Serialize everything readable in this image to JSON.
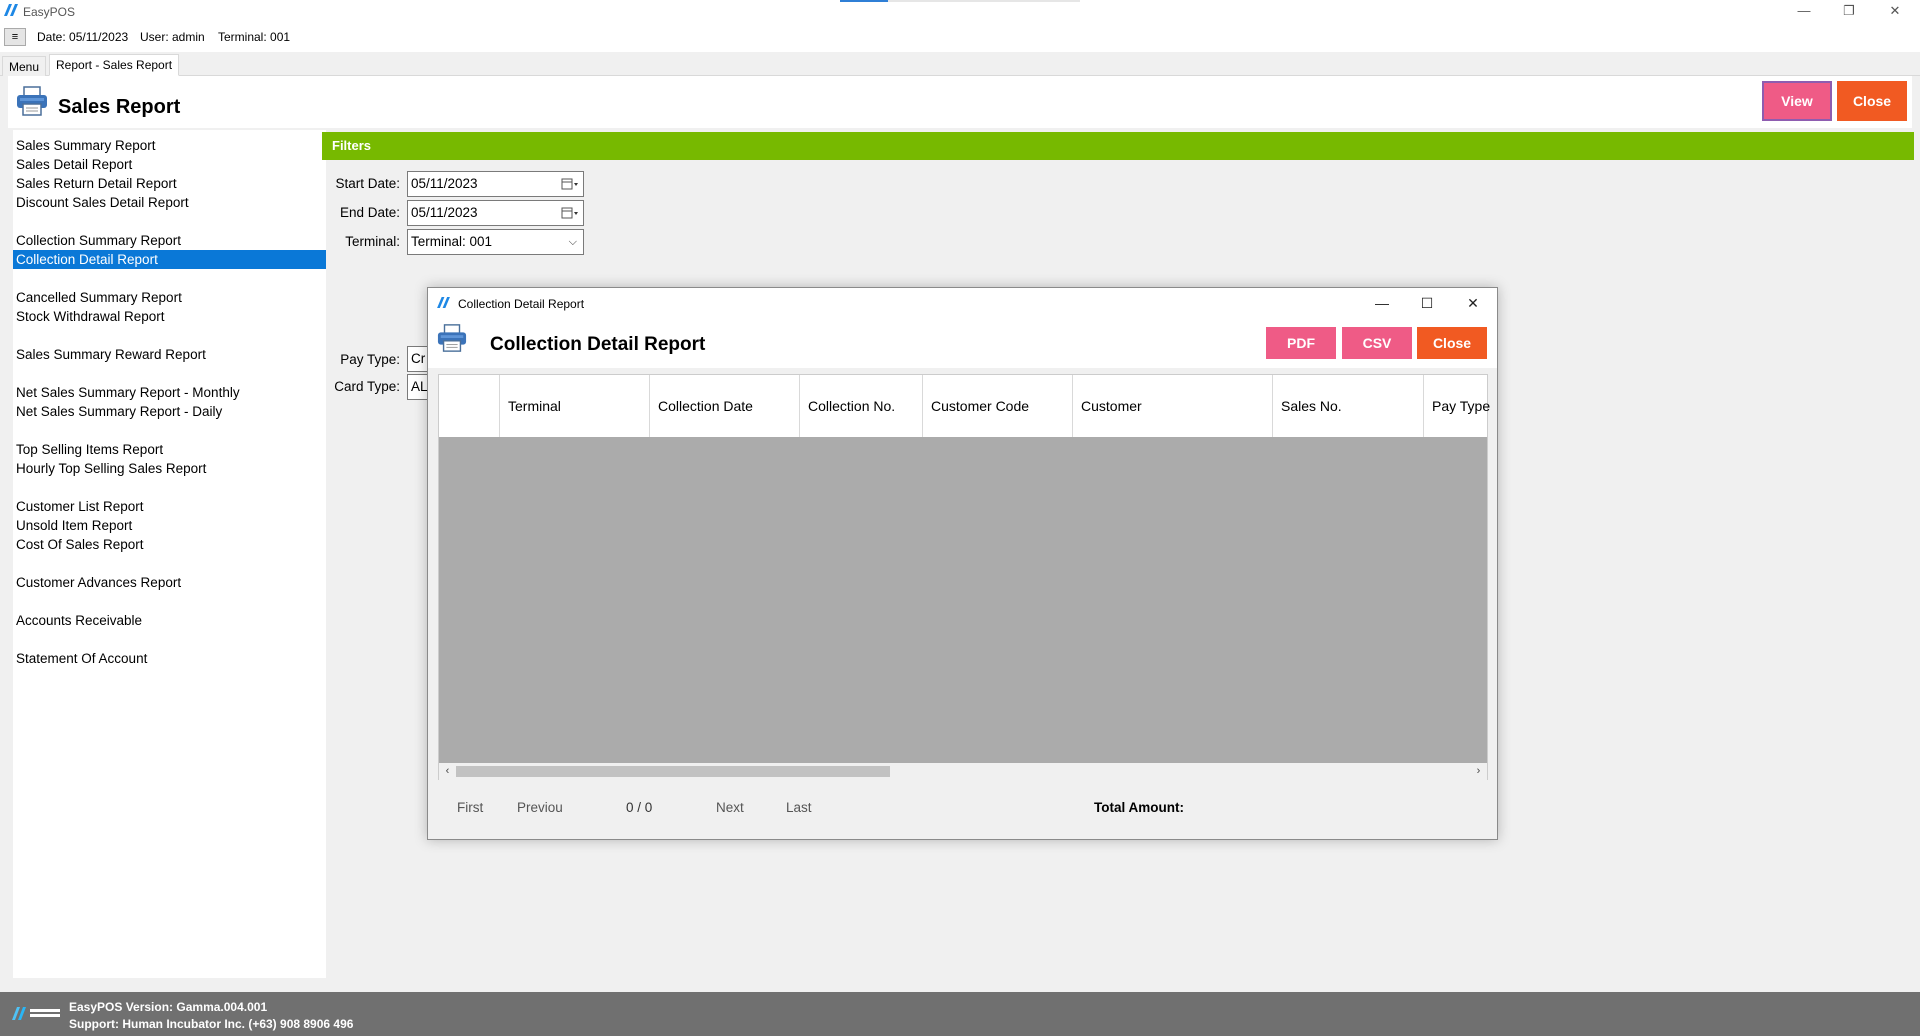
{
  "app": {
    "title": "EasyPOS"
  },
  "infobar": {
    "menu_glyph": "≡",
    "date": "Date: 05/11/2023",
    "user": "User: admin",
    "terminal": "Terminal: 001"
  },
  "tabs": [
    {
      "label": "Menu"
    },
    {
      "label": "Report - Sales Report"
    }
  ],
  "header": {
    "title": "Sales Report",
    "view_label": "View",
    "close_label": "Close"
  },
  "colors": {
    "accent_green": "#77b900",
    "pink": "#ef5b86",
    "orange": "#f15a22",
    "select_blue": "#0a78d7"
  },
  "sidebar": {
    "items": [
      {
        "label": "Sales Summary Report"
      },
      {
        "label": "Sales Detail Report"
      },
      {
        "label": "Sales Return Detail Report"
      },
      {
        "label": "Discount Sales Detail Report"
      },
      {
        "label": "Collection Summary Report"
      },
      {
        "label": "Collection Detail Report",
        "selected": true
      },
      {
        "label": "Cancelled Summary Report"
      },
      {
        "label": "Stock Withdrawal Report"
      },
      {
        "label": "Sales Summary Reward Report"
      },
      {
        "label": "Net Sales Summary Report - Monthly"
      },
      {
        "label": "Net Sales Summary Report - Daily"
      },
      {
        "label": "Top Selling Items Report"
      },
      {
        "label": "Hourly Top Selling Sales Report"
      },
      {
        "label": "Customer List Report"
      },
      {
        "label": "Unsold Item Report"
      },
      {
        "label": "Cost Of Sales Report"
      },
      {
        "label": "Customer Advances Report"
      },
      {
        "label": "Accounts Receivable"
      },
      {
        "label": "Statement Of Account"
      }
    ]
  },
  "filters": {
    "title": "Filters",
    "start_date_label": "Start Date:",
    "start_date": "05/11/2023",
    "end_date_label": "End Date:",
    "end_date": "05/11/2023",
    "terminal_label": "Terminal:",
    "terminal": "Terminal: 001",
    "pay_type_label": "Pay Type:",
    "pay_type": "Cr",
    "card_type_label": "Card Type:",
    "card_type": "AL"
  },
  "dialog": {
    "window_title": "Collection Detail Report",
    "heading": "Collection Detail Report",
    "pdf_label": "PDF",
    "csv_label": "CSV",
    "close_label": "Close",
    "columns": [
      "",
      "Terminal",
      "Collection Date",
      "Collection No.",
      "Customer Code",
      "Customer",
      "Sales No.",
      "Pay Type"
    ],
    "pager": {
      "first": "First",
      "previous": "Previou",
      "position": "0 / 0",
      "next": "Next",
      "last": "Last",
      "total_label": "Total Amount:"
    }
  },
  "footer": {
    "version": "EasyPOS Version: Gamma.004.001",
    "support": "Support: Human Incubator Inc. (+63) 908 8906 496"
  }
}
